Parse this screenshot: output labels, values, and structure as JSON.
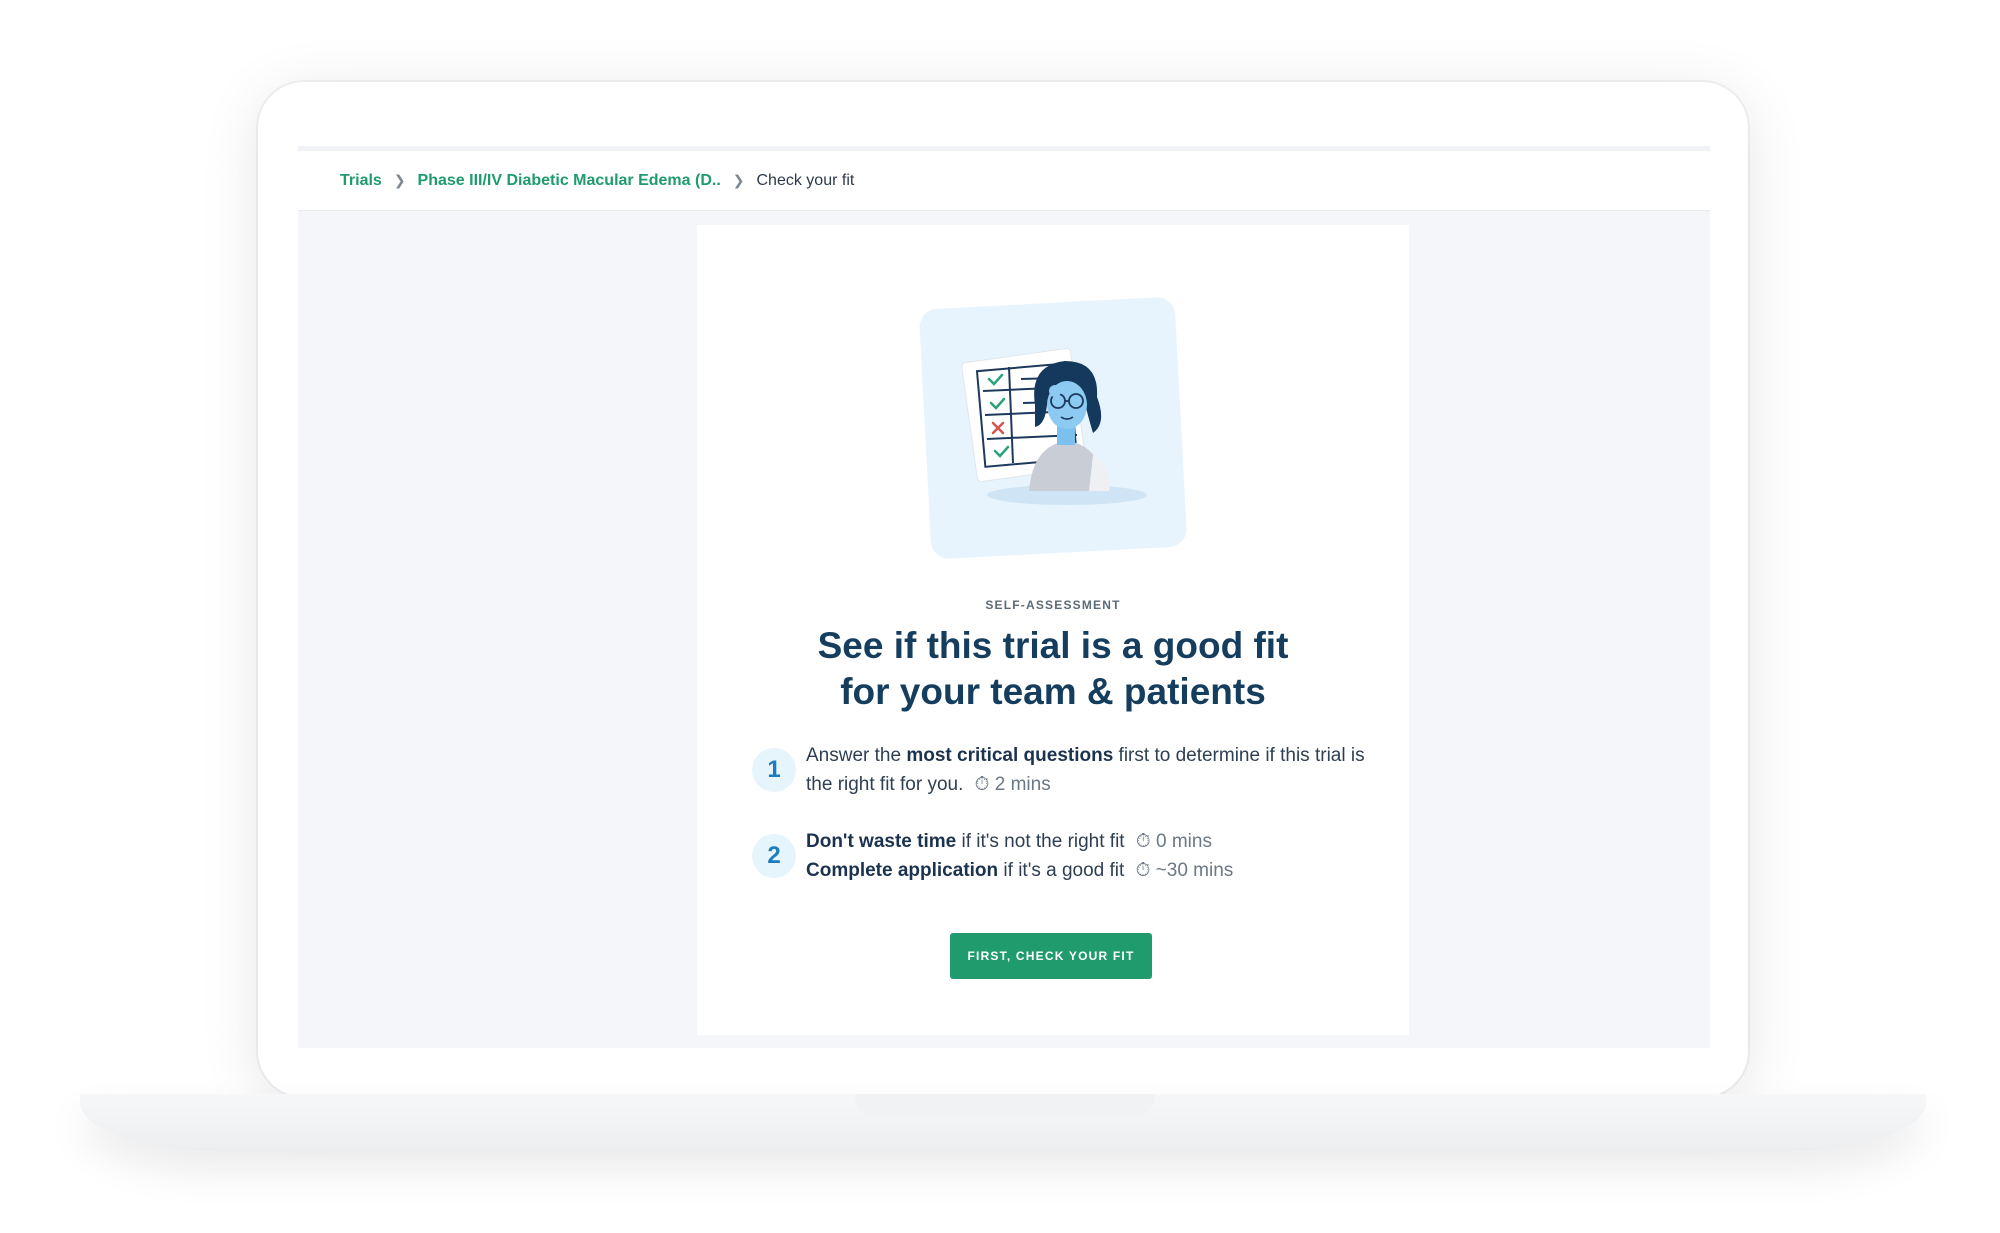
{
  "breadcrumb": {
    "items": [
      "Trials",
      "Phase III/IV Diabetic Macular Edema (D..",
      "Check your fit"
    ]
  },
  "card": {
    "eyebrow": "SELF-ASSESSMENT",
    "title_line1": "See if this trial is a good fit",
    "title_line2": "for your team & patients",
    "steps": [
      {
        "number": "1",
        "pre": "Answer the ",
        "bold": "most critical questions",
        "post": " first to determine if this trial is the right fit for you.",
        "time": "2 mins"
      },
      {
        "number": "2",
        "line1_bold": "Don't waste time",
        "line1_text": " if it's not the right fit",
        "line1_time": "0 mins",
        "line2_bold": "Complete application",
        "line2_text": " if it's a good fit",
        "line2_time": "~30 mins"
      }
    ],
    "cta_label": "FIRST, CHECK YOUR FIT"
  },
  "colors": {
    "accent": "#1f9b6e",
    "title": "#143d5e",
    "step_badge_bg": "#e6f4fb",
    "step_badge_text": "#1b7cbf"
  },
  "icons": [
    "chevron-right-icon",
    "stopwatch-icon",
    "checklist-illustration"
  ]
}
